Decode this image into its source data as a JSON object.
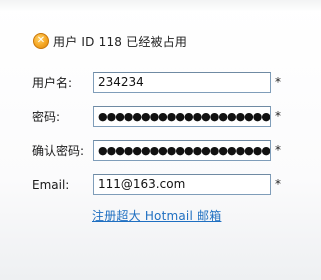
{
  "error": {
    "icon": "close-icon",
    "text": "用户  ID 118 已经被占用"
  },
  "form": {
    "username_label": "用户名:",
    "username_value": "234234",
    "password_label": "密码:",
    "password_value": "●●●●●●●●●●●●●●●●●●●●",
    "confirm_label": "确认密码:",
    "confirm_value": "●●●●●●●●●●●●●●●●●●●●",
    "email_label": "Email:",
    "email_value": "111@163.com",
    "required_mark": "*"
  },
  "link": {
    "register_text": "注册超大 Hotmail 邮箱"
  },
  "colors": {
    "link": "#1e6fc1",
    "field_border": "#7f9db9",
    "error_icon": "#f5a623"
  }
}
